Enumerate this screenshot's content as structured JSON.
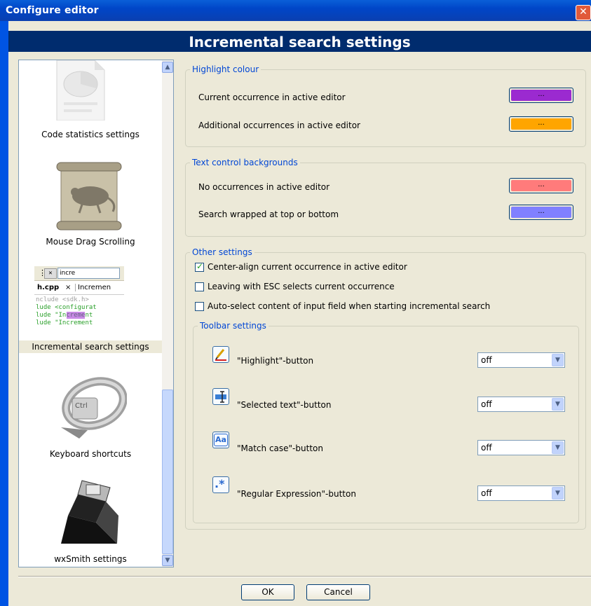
{
  "window": {
    "title": "Configure editor",
    "close_glyph": "✕"
  },
  "header": {
    "title": "Incremental search settings"
  },
  "sidebar": {
    "items": [
      {
        "label": "Code statistics settings",
        "icon": "code-statistics-icon"
      },
      {
        "label": "Mouse Drag Scrolling",
        "icon": "mouse-scroll-icon"
      },
      {
        "label": "Incremental search settings",
        "icon": "incremental-search-icon",
        "selected": true
      },
      {
        "label": "Keyboard shortcuts",
        "icon": "keyboard-shortcuts-icon"
      },
      {
        "label": "wxSmith settings",
        "icon": "wxsmith-icon"
      }
    ],
    "preview": {
      "search_text": "incre",
      "tab1": "h.cpp",
      "tab2": "Incremen",
      "code_lines": [
        "nclude <sdk.h>",
        "lude <configurat",
        "lude \"Increment",
        "lude \"Increment"
      ]
    }
  },
  "highlight": {
    "title": "Highlight colour",
    "rows": [
      {
        "label": "Current occurrence in active editor",
        "color": "#9b2ad0",
        "button": "..."
      },
      {
        "label": "Additional occurrences in active editor",
        "color": "#ffa500",
        "button": "..."
      }
    ]
  },
  "text_backgrounds": {
    "title": "Text control backgrounds",
    "rows": [
      {
        "label": "No occurrences in active editor",
        "color": "#ff7b7b",
        "button": "..."
      },
      {
        "label": "Search wrapped at top or bottom",
        "color": "#8080ff",
        "button": "..."
      }
    ]
  },
  "other": {
    "title": "Other settings",
    "checks": [
      {
        "label": "Center-align current occurrence in active editor",
        "checked": true
      },
      {
        "label": "Leaving with ESC selects current occurrence",
        "checked": false
      },
      {
        "label": "Auto-select content of input field when starting incremental search",
        "checked": false
      }
    ]
  },
  "toolbar": {
    "title": "Toolbar settings",
    "rows": [
      {
        "label": "\"Highlight\"-button",
        "value": "off",
        "icon": "highlight-pencil-icon"
      },
      {
        "label": "\"Selected text\"-button",
        "value": "off",
        "icon": "selected-text-icon"
      },
      {
        "label": "\"Match case\"-button",
        "value": "off",
        "icon": "match-case-icon",
        "icon_text": "Aa"
      },
      {
        "label": "\"Regular Expression\"-button",
        "value": "off",
        "icon": "regex-icon",
        "icon_text": ".*"
      }
    ]
  },
  "buttons": {
    "ok": "OK",
    "cancel": "Cancel"
  }
}
